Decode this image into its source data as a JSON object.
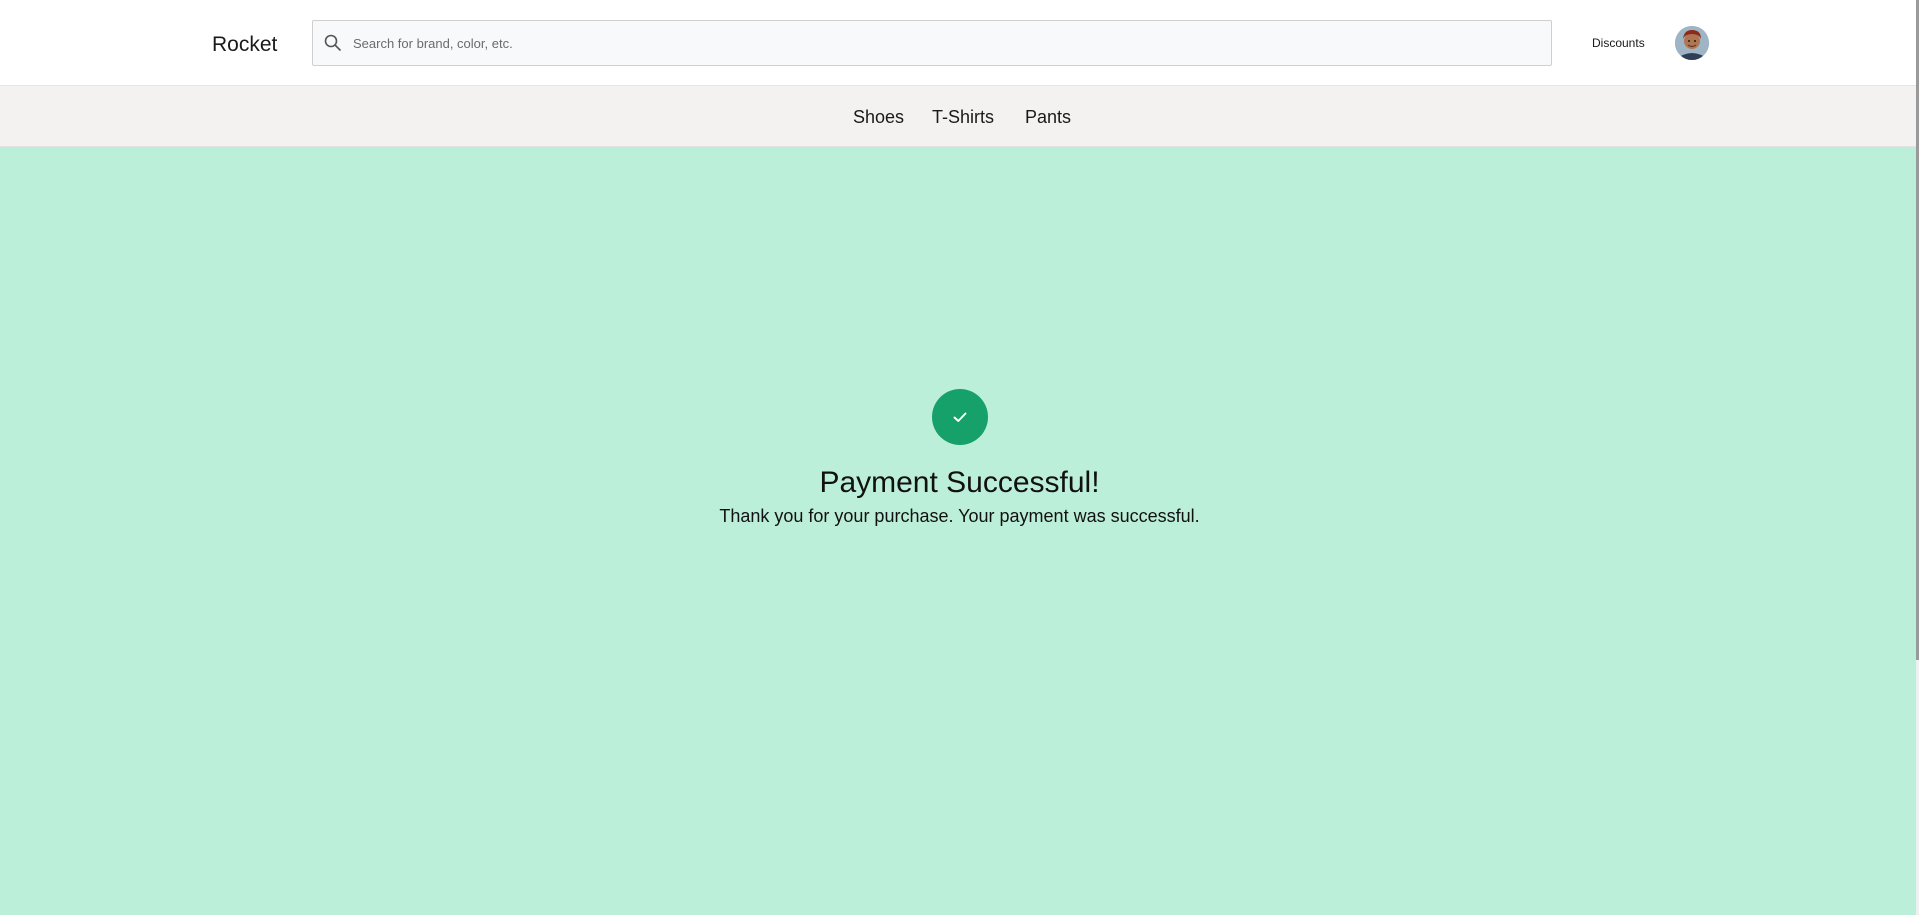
{
  "header": {
    "logo": "Rocket",
    "search": {
      "placeholder": "Search for brand, color, etc.",
      "value": ""
    },
    "discounts_label": "Discounts",
    "avatar_icon": "user-avatar"
  },
  "nav": {
    "items": [
      {
        "label": "Shoes"
      },
      {
        "label": "T-Shirts"
      },
      {
        "label": "Pants"
      }
    ]
  },
  "main": {
    "status_icon": "check-icon",
    "title": "Payment Successful!",
    "message": "Thank you for your purchase. Your payment was successful."
  },
  "colors": {
    "success_background": "#bcefd9",
    "success_icon": "#16a06a",
    "nav_background": "#f3f2f1"
  }
}
